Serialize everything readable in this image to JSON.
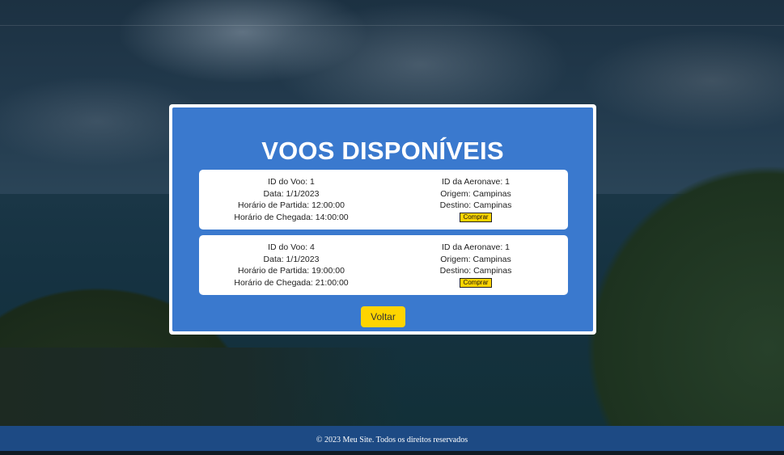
{
  "page": {
    "title": "VOOS DISPONÍVEIS"
  },
  "flights": [
    {
      "id_label": "ID do Voo: 1",
      "date_label": "Data: 1/1/2023",
      "departure_label": "Horário de Partida: 12:00:00",
      "arrival_label": "Horário de Chegada: 14:00:00",
      "aircraft_label": "ID da Aeronave: 1",
      "origin_label": "Origem: Campinas",
      "destination_label": "Destino: Campinas",
      "buy_label": "Comprar"
    },
    {
      "id_label": "ID do Voo: 4",
      "date_label": "Data: 1/1/2023",
      "departure_label": "Horário de Partida: 19:00:00",
      "arrival_label": "Horário de Chegada: 21:00:00",
      "aircraft_label": "ID da Aeronave: 1",
      "origin_label": "Origem: Campinas",
      "destination_label": "Destino: Campinas",
      "buy_label": "Comprar"
    }
  ],
  "actions": {
    "back_label": "Voltar"
  },
  "footer": {
    "text": "© 2023 Meu Site. Todos os direitos reservados"
  },
  "colors": {
    "panel_blue": "#3a79ce",
    "button_yellow": "#ffd400",
    "footer_blue": "#1d4a84"
  }
}
